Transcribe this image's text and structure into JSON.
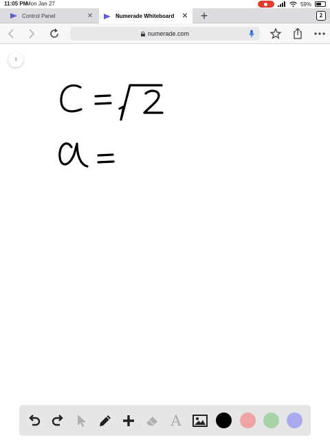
{
  "status_bar": {
    "time": "11:05 PM",
    "date": "Mon Jan 27",
    "battery": "59%",
    "battery_level": 0.59,
    "recording_color": "#e33b2c"
  },
  "tabs": [
    {
      "label": "Control Panel",
      "active": false,
      "icon": "numerade-play-icon"
    },
    {
      "label": "Numerade Whiteboard",
      "active": true,
      "icon": "numerade-play-icon"
    }
  ],
  "tab_count": "2",
  "browser": {
    "url": "numerade.com"
  },
  "whiteboard": {
    "page_number": "1",
    "handwriting": [
      "C = √2",
      "a ="
    ]
  },
  "drawing_tools": [
    "undo-icon",
    "redo-icon",
    "pointer-icon",
    "pen-icon",
    "add-icon",
    "eraser-icon",
    "text-icon",
    "image-icon"
  ],
  "colors": {
    "accent": "#5b5bd6",
    "swatches": [
      "#000000",
      "#f0a3a3",
      "#a7d3a7",
      "#a9a9f0"
    ]
  }
}
